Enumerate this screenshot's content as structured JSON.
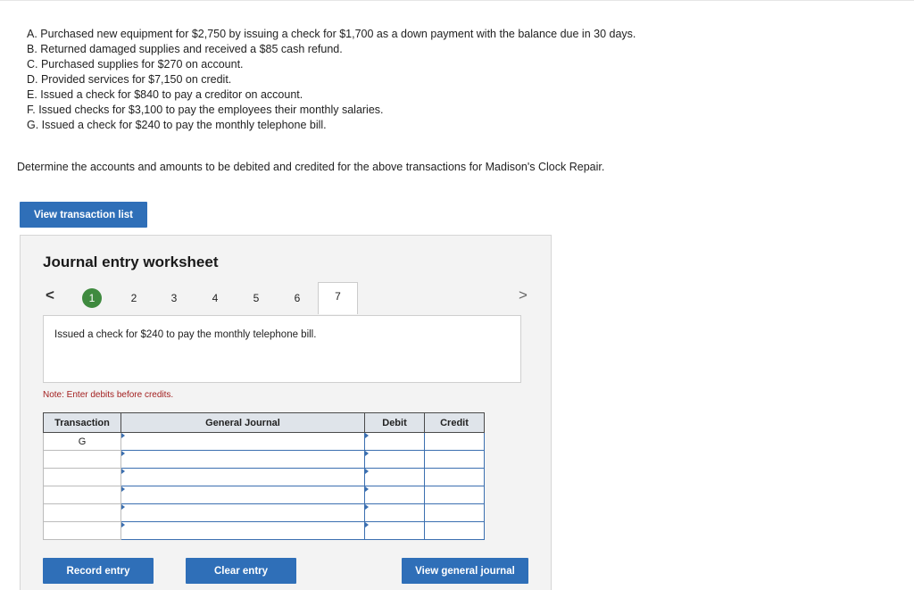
{
  "transactions": [
    "A. Purchased new equipment for $2,750 by issuing a check for $1,700 as a down payment with the balance due in 30 days.",
    "B. Returned damaged supplies and received a $85 cash refund.",
    "C. Purchased supplies for $270 on account.",
    "D. Provided services for $7,150 on credit.",
    "E. Issued a check for $840 to pay a creditor on account.",
    "F. Issued checks for $3,100 to pay the employees their monthly salaries.",
    "G. Issued a check for $240 to pay the monthly telephone bill."
  ],
  "instruction": "Determine the accounts and amounts to be debited and credited for the above transactions for Madison's Clock Repair.",
  "buttons": {
    "view_transaction_list": "View transaction list",
    "record_entry": "Record entry",
    "clear_entry": "Clear entry",
    "view_general_journal": "View general journal"
  },
  "worksheet": {
    "title": "Journal entry worksheet",
    "prev_arrow": "<",
    "next_arrow": ">",
    "steps": [
      "1",
      "2",
      "3",
      "4",
      "5",
      "6",
      "7"
    ],
    "completed_step": "1",
    "active_step": "7",
    "description": "Issued a check for $240 to pay the monthly telephone bill.",
    "note": "Note: Enter debits before credits."
  },
  "journal": {
    "headers": [
      "Transaction",
      "General Journal",
      "Debit",
      "Credit"
    ],
    "rows": [
      {
        "transaction": "G",
        "account": "",
        "debit": "",
        "credit": ""
      },
      {
        "transaction": "",
        "account": "",
        "debit": "",
        "credit": ""
      },
      {
        "transaction": "",
        "account": "",
        "debit": "",
        "credit": ""
      },
      {
        "transaction": "",
        "account": "",
        "debit": "",
        "credit": ""
      },
      {
        "transaction": "",
        "account": "",
        "debit": "",
        "credit": ""
      },
      {
        "transaction": "",
        "account": "",
        "debit": "",
        "credit": ""
      }
    ]
  },
  "colors": {
    "button_blue": "#2f6fb8",
    "completed_step_green": "#3f8a3f",
    "note_red": "#a32020"
  }
}
